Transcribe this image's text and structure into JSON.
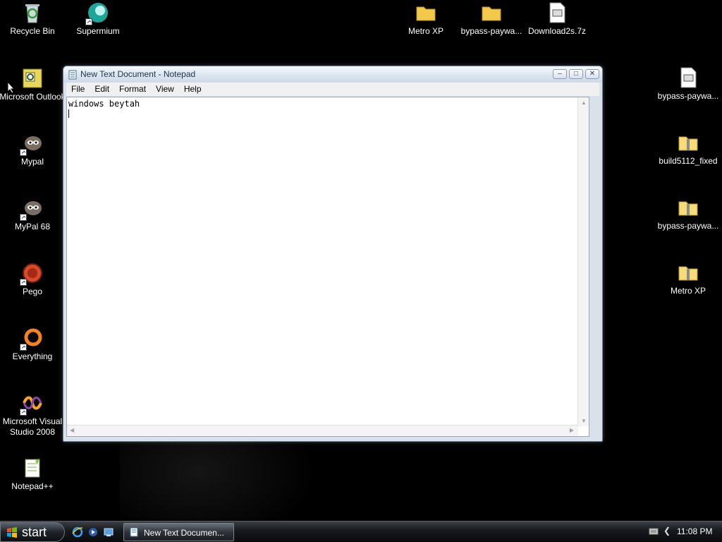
{
  "desktop": {
    "icons_left": [
      {
        "label": "Recycle Bin",
        "icon": "recycle-bin-icon"
      },
      {
        "label": "Microsoft Outlook",
        "icon": "outlook-icon"
      },
      {
        "label": "Mypal",
        "icon": "mypal-icon"
      },
      {
        "label": "MyPal 68",
        "icon": "mypal68-icon"
      },
      {
        "label": "Pego",
        "icon": "pego-icon"
      },
      {
        "label": "Everything",
        "icon": "everything-icon"
      },
      {
        "label": "Microsoft Visual Studio 2008",
        "icon": "visual-studio-icon"
      },
      {
        "label": "Notepad++",
        "icon": "notepadpp-icon"
      }
    ],
    "icons_top": [
      {
        "label": "Supermium",
        "icon": "supermium-icon"
      },
      {
        "label": "Metro XP",
        "icon": "folder-icon"
      },
      {
        "label": "bypass-paywa...",
        "icon": "folder-icon"
      },
      {
        "label": "Download2s.7z",
        "icon": "archive-file-icon"
      }
    ],
    "icons_right": [
      {
        "label": "bypass-paywa...",
        "icon": "archive-file-icon"
      },
      {
        "label": "build5112_fixed",
        "icon": "zip-folder-icon"
      },
      {
        "label": "bypass-paywa...",
        "icon": "zip-folder-icon"
      },
      {
        "label": "Metro XP",
        "icon": "zip-folder-icon"
      }
    ]
  },
  "notepad": {
    "title": "New Text Document - Notepad",
    "menu": [
      "File",
      "Edit",
      "Format",
      "View",
      "Help"
    ],
    "content": "windows beytah",
    "window_buttons": {
      "minimize": "–",
      "maximize": "□",
      "close": "✕"
    }
  },
  "taskbar": {
    "start_label": "start",
    "task_label": "New Text Documen...",
    "clock": "11:08 PM"
  },
  "colors": {
    "desktop_bg": "#000000",
    "titlebar": "#dbe5ef",
    "taskbar": "#15181c"
  }
}
